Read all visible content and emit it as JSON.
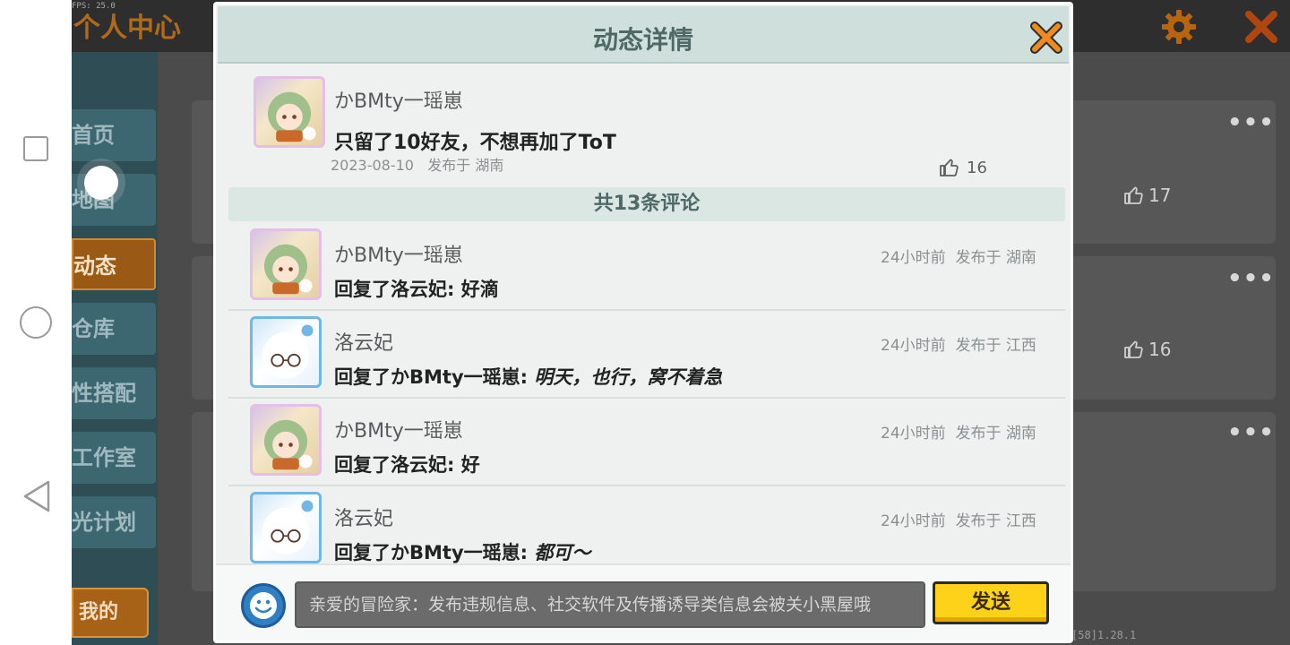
{
  "system": {
    "fps_label": "FPS: 25.0"
  },
  "background": {
    "title": "个人中心",
    "menu": [
      "首页",
      "地图",
      "动态",
      "仓库",
      "性搭配",
      "工作室",
      "光计划"
    ],
    "my_button": "我的",
    "cards": [
      {
        "likes": "17"
      },
      {
        "likes": "16"
      }
    ],
    "more": "•••",
    "version": "[58]1.28.1"
  },
  "dialog": {
    "title": "动态详情",
    "post": {
      "username": "かBMty一瑶崽",
      "text": "只留了10好友，不想再加了ToT",
      "date": "2023-08-10",
      "location": "发布于 湖南",
      "likes": "16"
    },
    "comment_count": "共13条评论",
    "comments": [
      {
        "username": "かBMty一瑶崽",
        "time": "24小时前",
        "location": "发布于 湖南",
        "prefix": "回复了洛云妃: ",
        "content": "好滴",
        "italic": false,
        "avatar": "green"
      },
      {
        "username": "洛云妃",
        "time": "24小时前",
        "location": "发布于 江西",
        "prefix": "回复了かBMty一瑶崽: ",
        "content": "明天，也行，窝不着急",
        "italic": true,
        "avatar": "white"
      },
      {
        "username": "かBMty一瑶崽",
        "time": "24小时前",
        "location": "发布于 湖南",
        "prefix": "回复了洛云妃: ",
        "content": "好",
        "italic": false,
        "avatar": "green"
      },
      {
        "username": "洛云妃",
        "time": "24小时前",
        "location": "发布于 江西",
        "prefix": "回复了かBMty一瑶崽: ",
        "content": "都可～",
        "italic": true,
        "avatar": "white"
      }
    ],
    "input": {
      "placeholder": "亲爱的冒险家：发布违规信息、社交软件及传播诱导类信息会被关小黑屋哦",
      "send_label": "发送"
    }
  },
  "icons": {
    "close": "close-icon",
    "gear": "gear-icon",
    "like": "thumbs-up-icon",
    "emoji": "smiley-icon"
  },
  "colors": {
    "accent_orange": "#f08a1c",
    "send_yellow": "#ffd21a",
    "header_teal": "#cfe0dc"
  }
}
